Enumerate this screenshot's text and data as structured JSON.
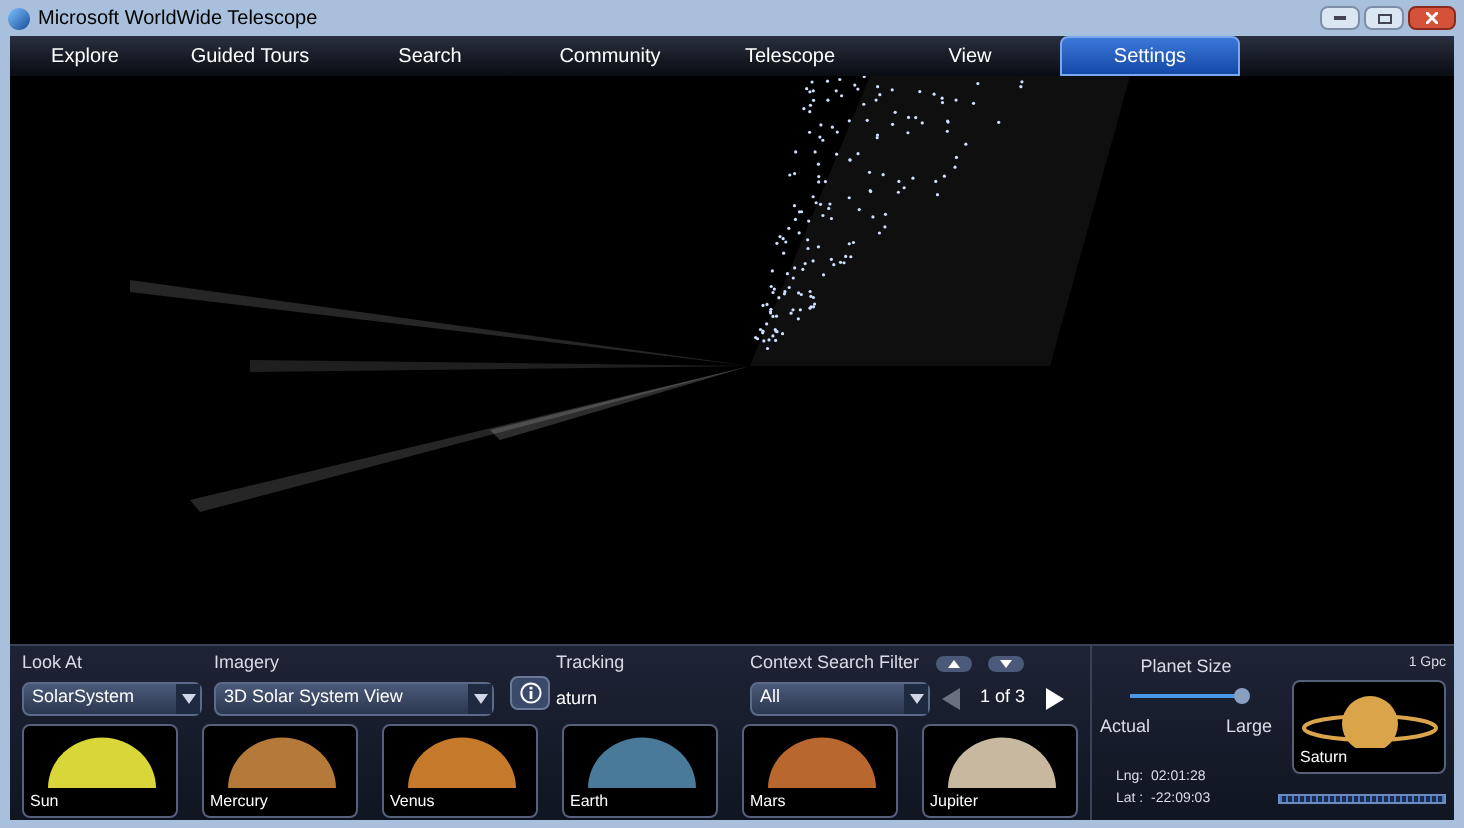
{
  "window": {
    "title": "Microsoft WorldWide Telescope"
  },
  "menu": [
    {
      "label": "Explore",
      "selected": false
    },
    {
      "label": "Guided Tours",
      "selected": false
    },
    {
      "label": "Search",
      "selected": false
    },
    {
      "label": "Community",
      "selected": false
    },
    {
      "label": "Telescope",
      "selected": false
    },
    {
      "label": "View",
      "selected": false
    },
    {
      "label": "Settings",
      "selected": true
    }
  ],
  "look_at": {
    "label": "Look At",
    "value": "SolarSystem"
  },
  "imagery": {
    "label": "Imagery",
    "value": "3D Solar System View"
  },
  "tracking": {
    "label": "Tracking",
    "value": "aturn"
  },
  "context_filter": {
    "label": "Context Search Filter",
    "value": "All",
    "page": "1 of 3",
    "prev_disabled": true,
    "next_disabled": false
  },
  "thumbnails": [
    {
      "label": "Sun",
      "color": "#d9d63a"
    },
    {
      "label": "Mercury",
      "color": "#b5793a"
    },
    {
      "label": "Venus",
      "color": "#c47a2a"
    },
    {
      "label": "Earth",
      "color": "#4a7a9a"
    },
    {
      "label": "Mars",
      "color": "#b8682e"
    },
    {
      "label": "Jupiter",
      "color": "#c9b8a0"
    }
  ],
  "planet_size": {
    "label": "Planet Size",
    "level": 1,
    "min_label": "Actual",
    "max_label": "Large"
  },
  "scale": "1 Gpc",
  "current": {
    "label": "Saturn",
    "color": "#d9a44a"
  },
  "coords": {
    "lng": "Lng:  02:01:28",
    "lat": "Lat :  -22:09:03"
  }
}
